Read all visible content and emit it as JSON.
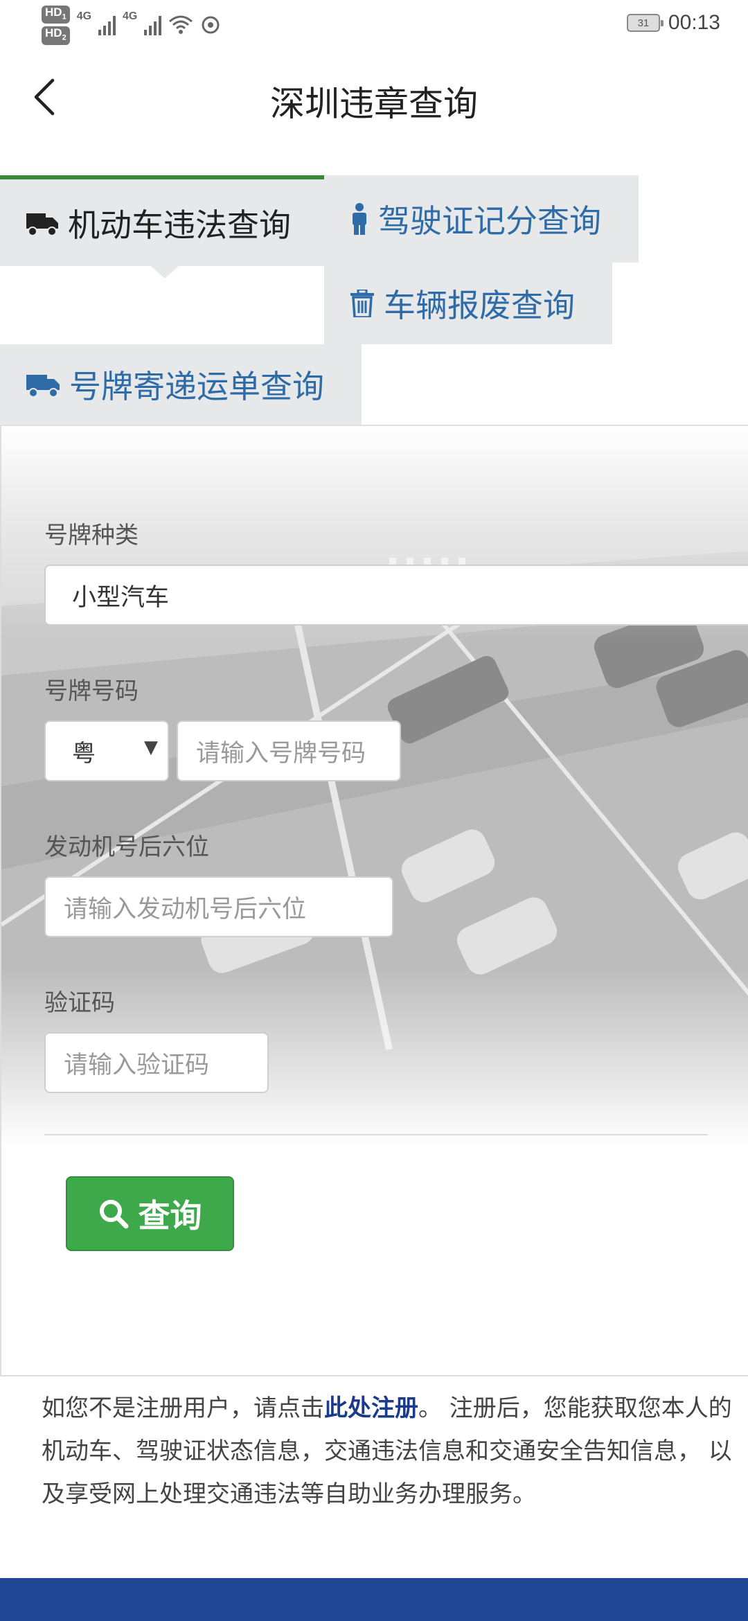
{
  "status_bar": {
    "hd1": "HD",
    "hd1_sub": "1",
    "hd2": "HD",
    "hd2_sub": "2",
    "net1": "4G",
    "net2": "4G",
    "battery": "31",
    "time": "00:13"
  },
  "header": {
    "title": "深圳违章查询"
  },
  "tabs": {
    "vehicle": "机动车违法查询",
    "license": "驾驶证记分查询",
    "scrap": "车辆报废查询",
    "plate": "号牌寄递运单查询"
  },
  "form": {
    "plate_type_label": "号牌种类",
    "plate_type_value": "小型汽车",
    "plate_no_label": "号牌号码",
    "province_value": "粤",
    "plate_no_placeholder": "请输入号牌号码",
    "engine_label": "发动机号后六位",
    "engine_placeholder": "请输入发动机号后六位",
    "captcha_label": "验证码",
    "captcha_placeholder": "请输入验证码",
    "search_label": "查询"
  },
  "notice": {
    "before": "如您不是注册用户，请点击",
    "link": "此处注册",
    "after": "。 注册后，您能获取您本人的机动车、驾驶证状态信息，交通违法信息和交通安全告知信息， 以及享受网上处理交通违法等自助业务办理服务。"
  },
  "colors": {
    "primary_green": "#3da94a",
    "tab_blue": "#2f6ca7",
    "footer_blue": "#1f4796"
  }
}
